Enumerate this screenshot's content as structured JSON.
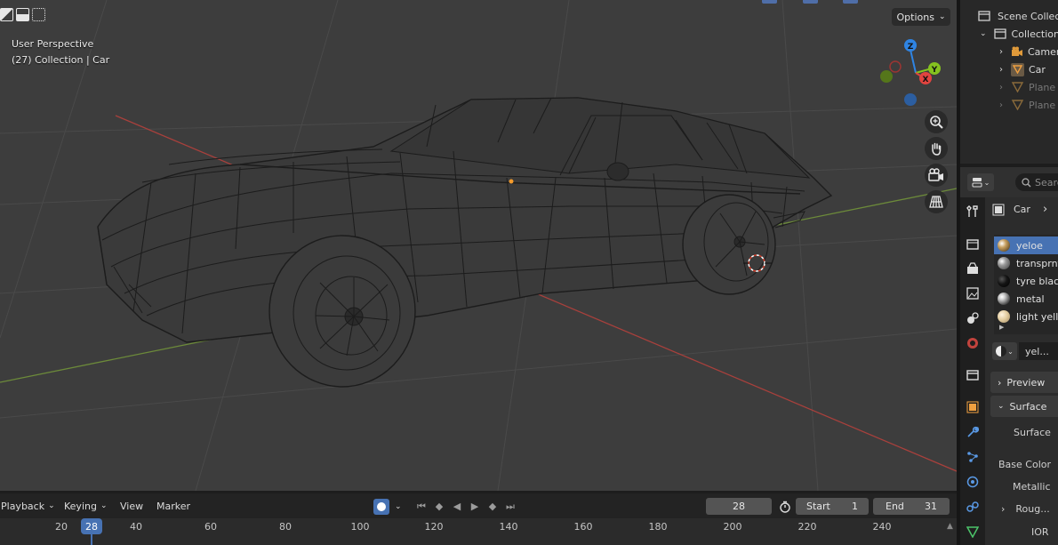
{
  "viewport": {
    "info_line1": "User Perspective",
    "info_line2": "(27) Collection | Car",
    "options_label": "Options",
    "gizmo": {
      "z": "Z",
      "y": "Y",
      "x": "X"
    },
    "tools": [
      "zoom-icon",
      "hand-icon",
      "camera-icon",
      "grid-icon"
    ]
  },
  "timeline": {
    "menu": [
      "Playback",
      "Keying",
      "View",
      "Marker"
    ],
    "current_frame": "28",
    "start_label": "Start",
    "start_value": "1",
    "end_label": "End",
    "end_value": "31",
    "ruler_ticks": [
      "20",
      "40",
      "60",
      "80",
      "100",
      "120",
      "140",
      "160",
      "180",
      "200",
      "220",
      "240"
    ],
    "ruler_current": "28"
  },
  "outliner": {
    "scene_collection": "Scene Collection",
    "collection": "Collection",
    "items": [
      "Camera",
      "Car",
      "Plane",
      "Plane"
    ]
  },
  "properties": {
    "search_placeholder": "Search",
    "object_name": "Car",
    "materials": [
      {
        "name": "yeloe",
        "color": "#c8a060",
        "active": true
      },
      {
        "name": "transprnt",
        "color": "#9a9a9a"
      },
      {
        "name": "tyre black",
        "color": "#141414"
      },
      {
        "name": "metal",
        "color": "#cfcfcf"
      },
      {
        "name": "light yellow",
        "color": "#e3cda0"
      }
    ],
    "material_slot_name": "yel...",
    "preview_label": "Preview",
    "surface_label": "Surface",
    "surface_value": "Surface",
    "base_color_label": "Base Color",
    "metallic_label": "Metallic",
    "roughness_label": "Roug...",
    "ior_label": "IOR"
  },
  "colors": {
    "accent": "#4772b3",
    "x_axis": "#e0443f",
    "y_axis": "#85c21f",
    "z_axis": "#2f84e3"
  }
}
